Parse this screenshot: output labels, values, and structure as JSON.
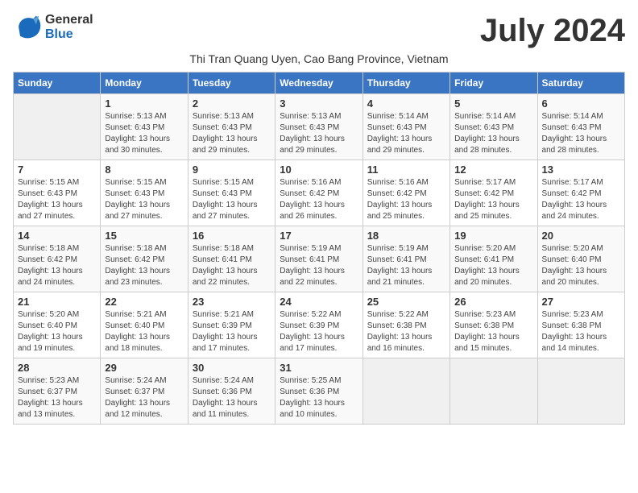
{
  "logo": {
    "line1": "General",
    "line2": "Blue"
  },
  "title": "July 2024",
  "subtitle": "Thi Tran Quang Uyen, Cao Bang Province, Vietnam",
  "days_of_week": [
    "Sunday",
    "Monday",
    "Tuesday",
    "Wednesday",
    "Thursday",
    "Friday",
    "Saturday"
  ],
  "weeks": [
    [
      {
        "day": "",
        "info": ""
      },
      {
        "day": "1",
        "info": "Sunrise: 5:13 AM\nSunset: 6:43 PM\nDaylight: 13 hours and 30 minutes."
      },
      {
        "day": "2",
        "info": "Sunrise: 5:13 AM\nSunset: 6:43 PM\nDaylight: 13 hours and 29 minutes."
      },
      {
        "day": "3",
        "info": "Sunrise: 5:13 AM\nSunset: 6:43 PM\nDaylight: 13 hours and 29 minutes."
      },
      {
        "day": "4",
        "info": "Sunrise: 5:14 AM\nSunset: 6:43 PM\nDaylight: 13 hours and 29 minutes."
      },
      {
        "day": "5",
        "info": "Sunrise: 5:14 AM\nSunset: 6:43 PM\nDaylight: 13 hours and 28 minutes."
      },
      {
        "day": "6",
        "info": "Sunrise: 5:14 AM\nSunset: 6:43 PM\nDaylight: 13 hours and 28 minutes."
      }
    ],
    [
      {
        "day": "7",
        "info": "Sunrise: 5:15 AM\nSunset: 6:43 PM\nDaylight: 13 hours and 27 minutes."
      },
      {
        "day": "8",
        "info": "Sunrise: 5:15 AM\nSunset: 6:43 PM\nDaylight: 13 hours and 27 minutes."
      },
      {
        "day": "9",
        "info": "Sunrise: 5:15 AM\nSunset: 6:43 PM\nDaylight: 13 hours and 27 minutes."
      },
      {
        "day": "10",
        "info": "Sunrise: 5:16 AM\nSunset: 6:42 PM\nDaylight: 13 hours and 26 minutes."
      },
      {
        "day": "11",
        "info": "Sunrise: 5:16 AM\nSunset: 6:42 PM\nDaylight: 13 hours and 25 minutes."
      },
      {
        "day": "12",
        "info": "Sunrise: 5:17 AM\nSunset: 6:42 PM\nDaylight: 13 hours and 25 minutes."
      },
      {
        "day": "13",
        "info": "Sunrise: 5:17 AM\nSunset: 6:42 PM\nDaylight: 13 hours and 24 minutes."
      }
    ],
    [
      {
        "day": "14",
        "info": "Sunrise: 5:18 AM\nSunset: 6:42 PM\nDaylight: 13 hours and 24 minutes."
      },
      {
        "day": "15",
        "info": "Sunrise: 5:18 AM\nSunset: 6:42 PM\nDaylight: 13 hours and 23 minutes."
      },
      {
        "day": "16",
        "info": "Sunrise: 5:18 AM\nSunset: 6:41 PM\nDaylight: 13 hours and 22 minutes."
      },
      {
        "day": "17",
        "info": "Sunrise: 5:19 AM\nSunset: 6:41 PM\nDaylight: 13 hours and 22 minutes."
      },
      {
        "day": "18",
        "info": "Sunrise: 5:19 AM\nSunset: 6:41 PM\nDaylight: 13 hours and 21 minutes."
      },
      {
        "day": "19",
        "info": "Sunrise: 5:20 AM\nSunset: 6:41 PM\nDaylight: 13 hours and 20 minutes."
      },
      {
        "day": "20",
        "info": "Sunrise: 5:20 AM\nSunset: 6:40 PM\nDaylight: 13 hours and 20 minutes."
      }
    ],
    [
      {
        "day": "21",
        "info": "Sunrise: 5:20 AM\nSunset: 6:40 PM\nDaylight: 13 hours and 19 minutes."
      },
      {
        "day": "22",
        "info": "Sunrise: 5:21 AM\nSunset: 6:40 PM\nDaylight: 13 hours and 18 minutes."
      },
      {
        "day": "23",
        "info": "Sunrise: 5:21 AM\nSunset: 6:39 PM\nDaylight: 13 hours and 17 minutes."
      },
      {
        "day": "24",
        "info": "Sunrise: 5:22 AM\nSunset: 6:39 PM\nDaylight: 13 hours and 17 minutes."
      },
      {
        "day": "25",
        "info": "Sunrise: 5:22 AM\nSunset: 6:38 PM\nDaylight: 13 hours and 16 minutes."
      },
      {
        "day": "26",
        "info": "Sunrise: 5:23 AM\nSunset: 6:38 PM\nDaylight: 13 hours and 15 minutes."
      },
      {
        "day": "27",
        "info": "Sunrise: 5:23 AM\nSunset: 6:38 PM\nDaylight: 13 hours and 14 minutes."
      }
    ],
    [
      {
        "day": "28",
        "info": "Sunrise: 5:23 AM\nSunset: 6:37 PM\nDaylight: 13 hours and 13 minutes."
      },
      {
        "day": "29",
        "info": "Sunrise: 5:24 AM\nSunset: 6:37 PM\nDaylight: 13 hours and 12 minutes."
      },
      {
        "day": "30",
        "info": "Sunrise: 5:24 AM\nSunset: 6:36 PM\nDaylight: 13 hours and 11 minutes."
      },
      {
        "day": "31",
        "info": "Sunrise: 5:25 AM\nSunset: 6:36 PM\nDaylight: 13 hours and 10 minutes."
      },
      {
        "day": "",
        "info": ""
      },
      {
        "day": "",
        "info": ""
      },
      {
        "day": "",
        "info": ""
      }
    ]
  ]
}
